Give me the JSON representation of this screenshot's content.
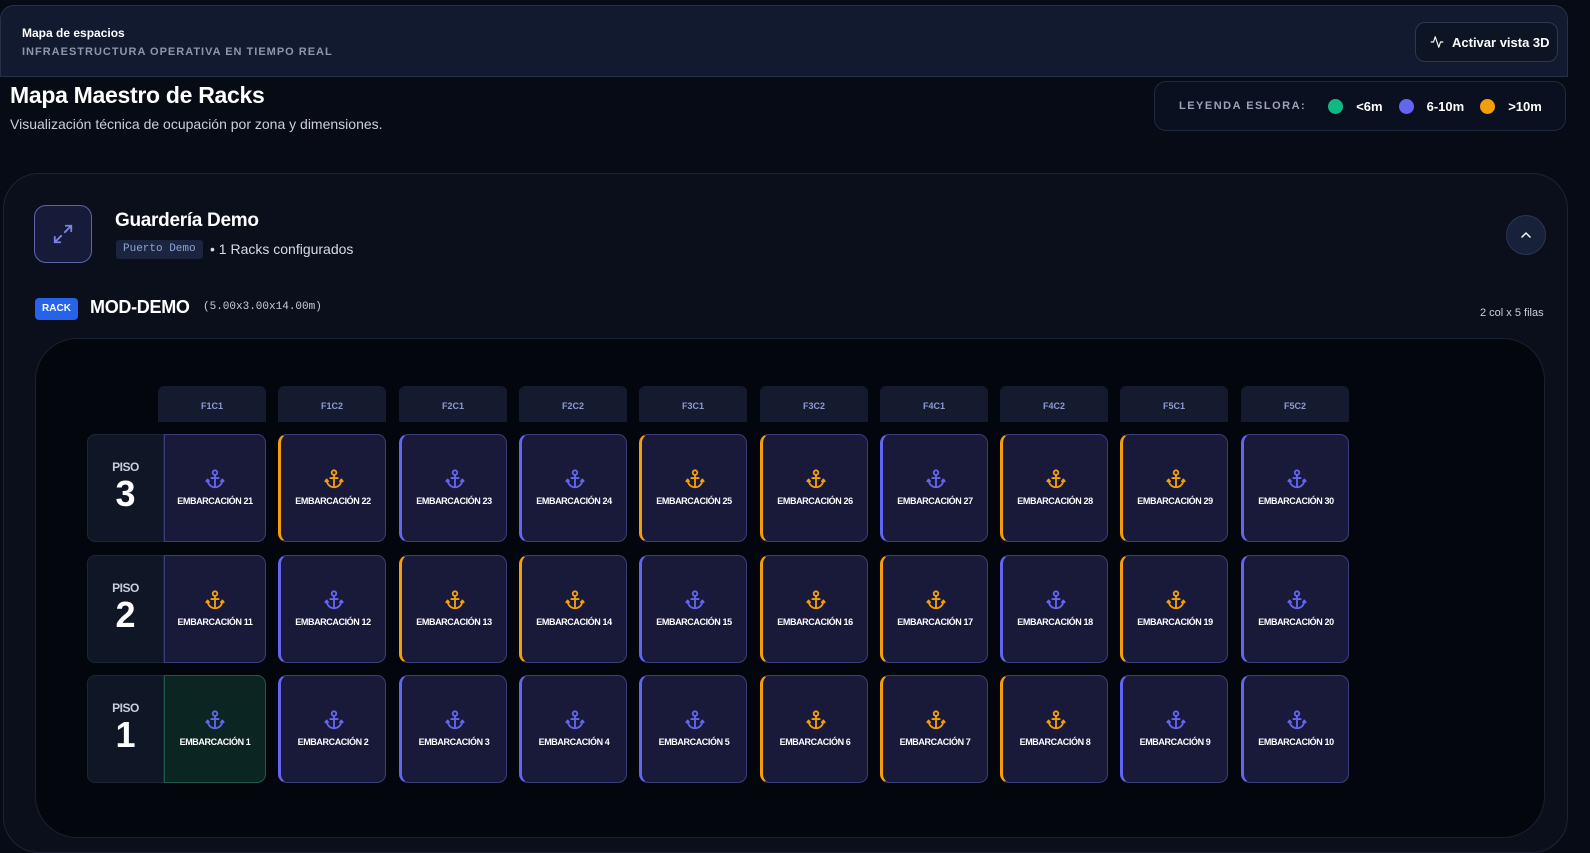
{
  "header": {
    "title": "Mapa de espacios",
    "subtitle": "INFRAESTRUCTURA OPERATIVA EN TIEMPO REAL",
    "activate_3d_label": "Activar vista 3D"
  },
  "page": {
    "title": "Mapa Maestro de Racks",
    "subtitle": "Visualización técnica de ocupación por zona y dimensiones."
  },
  "legend": {
    "title": "LEYENDA ESLORA:",
    "items": [
      {
        "label": "<6m",
        "color": "#10b981"
      },
      {
        "label": "6-10m",
        "color": "#6366f1"
      },
      {
        "label": ">10m",
        "color": "#f59e0b"
      }
    ]
  },
  "yard": {
    "name": "Guardería Demo",
    "tag": "Puerto Demo",
    "racks_count_text": "• 1 Racks configurados"
  },
  "rack": {
    "badge": "RACK",
    "name": "MOD-DEMO",
    "dimensions": "(5.00x3.00x14.00m)",
    "layout": "2 col x 5 filas",
    "columns": [
      "F1C1",
      "F1C2",
      "F2C1",
      "F2C2",
      "F3C1",
      "F3C2",
      "F4C1",
      "F4C2",
      "F5C1",
      "F5C2"
    ],
    "floors": [
      {
        "label": "PISO",
        "number": "3",
        "cells": [
          {
            "label": "EMBARCACIÓN 21",
            "size": "md"
          },
          {
            "label": "EMBARCACIÓN 22",
            "size": "lg"
          },
          {
            "label": "EMBARCACIÓN 23",
            "size": "md"
          },
          {
            "label": "EMBARCACIÓN 24",
            "size": "md"
          },
          {
            "label": "EMBARCACIÓN 25",
            "size": "lg"
          },
          {
            "label": "EMBARCACIÓN 26",
            "size": "lg"
          },
          {
            "label": "EMBARCACIÓN 27",
            "size": "md"
          },
          {
            "label": "EMBARCACIÓN 28",
            "size": "lg"
          },
          {
            "label": "EMBARCACIÓN 29",
            "size": "lg"
          },
          {
            "label": "EMBARCACIÓN 30",
            "size": "md"
          }
        ]
      },
      {
        "label": "PISO",
        "number": "2",
        "cells": [
          {
            "label": "EMBARCACIÓN 11",
            "size": "lg"
          },
          {
            "label": "EMBARCACIÓN 12",
            "size": "md"
          },
          {
            "label": "EMBARCACIÓN 13",
            "size": "lg"
          },
          {
            "label": "EMBARCACIÓN 14",
            "size": "lg"
          },
          {
            "label": "EMBARCACIÓN 15",
            "size": "md"
          },
          {
            "label": "EMBARCACIÓN 16",
            "size": "lg"
          },
          {
            "label": "EMBARCACIÓN 17",
            "size": "lg"
          },
          {
            "label": "EMBARCACIÓN 18",
            "size": "md"
          },
          {
            "label": "EMBARCACIÓN 19",
            "size": "lg"
          },
          {
            "label": "EMBARCACIÓN 20",
            "size": "md"
          }
        ]
      },
      {
        "label": "PISO",
        "number": "1",
        "cells": [
          {
            "label": "EMBARCACIÓN 1",
            "size": "sm"
          },
          {
            "label": "EMBARCACIÓN 2",
            "size": "md"
          },
          {
            "label": "EMBARCACIÓN 3",
            "size": "md"
          },
          {
            "label": "EMBARCACIÓN 4",
            "size": "md"
          },
          {
            "label": "EMBARCACIÓN 5",
            "size": "md"
          },
          {
            "label": "EMBARCACIÓN 6",
            "size": "lg"
          },
          {
            "label": "EMBARCACIÓN 7",
            "size": "lg"
          },
          {
            "label": "EMBARCACIÓN 8",
            "size": "lg"
          },
          {
            "label": "EMBARCACIÓN 9",
            "size": "md"
          },
          {
            "label": "EMBARCACIÓN 10",
            "size": "md"
          }
        ]
      }
    ]
  }
}
